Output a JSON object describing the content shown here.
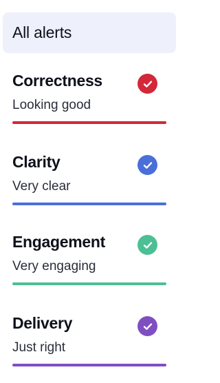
{
  "all_alerts": {
    "label": "All alerts"
  },
  "cards": [
    {
      "title": "Correctness",
      "status": "Looking good",
      "color": "#d3283a",
      "icon": "check-circle-icon"
    },
    {
      "title": "Clarity",
      "status": "Very clear",
      "color": "#4a6fd8",
      "icon": "check-circle-icon"
    },
    {
      "title": "Engagement",
      "status": "Very engaging",
      "color": "#4cbf94",
      "icon": "check-circle-icon"
    },
    {
      "title": "Delivery",
      "status": "Just right",
      "color": "#7f4fc2",
      "icon": "check-circle-icon"
    }
  ]
}
